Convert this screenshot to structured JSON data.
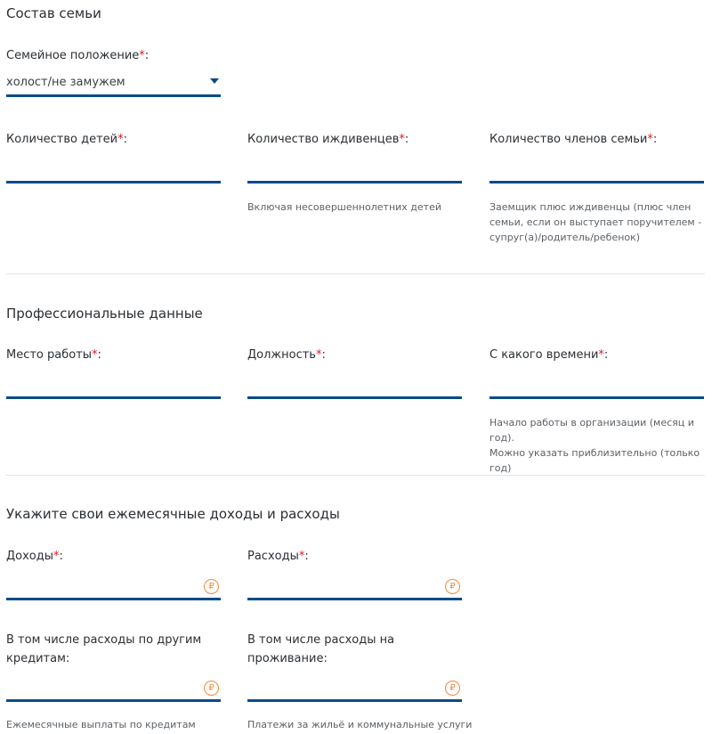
{
  "sections": {
    "family": {
      "title": "Состав семьи",
      "marital": {
        "label": "Семейное положение",
        "value": "холост/не замужем"
      },
      "children": {
        "label": "Количество детей"
      },
      "dependents": {
        "label": "Количество иждивенцев",
        "hint": "Включая несовершеннолетних детей"
      },
      "members": {
        "label": "Количество членов семьи",
        "hint_lines": [
          "Заемщик плюс иждивенцы (плюс член",
          "семьи, если он выступает поручителем -",
          "супруг(а)/родитель/ребенок)"
        ]
      }
    },
    "professional": {
      "title": "Профессиональные данные",
      "workplace": {
        "label": "Место работы"
      },
      "position": {
        "label": "Должность"
      },
      "since": {
        "label": "С какого времени",
        "hint_lines": [
          "Начало работы в организации (месяц и год).",
          "Можно указать приблизительно (только год)"
        ]
      }
    },
    "finance": {
      "title": "Укажите свои ежемесячные доходы и расходы",
      "income": {
        "label": "Доходы"
      },
      "expenses": {
        "label": "Расходы"
      },
      "other_credits": {
        "label_lines": [
          "В том числе расходы по другим",
          "кредитам:"
        ],
        "hint": "Ежемесячные выплаты по кредитам"
      },
      "living": {
        "label_lines": [
          "В том числе расходы на",
          "проживание:"
        ],
        "hint": "Платежи за жильё и коммунальные услуги"
      }
    }
  },
  "common": {
    "required_mark": "*",
    "colon": ":",
    "currency_symbol": "₽",
    "accent_color": "#0b4b8a",
    "required_color": "#e4161e",
    "currency_color": "#f08a3a",
    "icons": {
      "select_arrow": "chevron-down-icon",
      "currency": "ruble-icon"
    }
  }
}
